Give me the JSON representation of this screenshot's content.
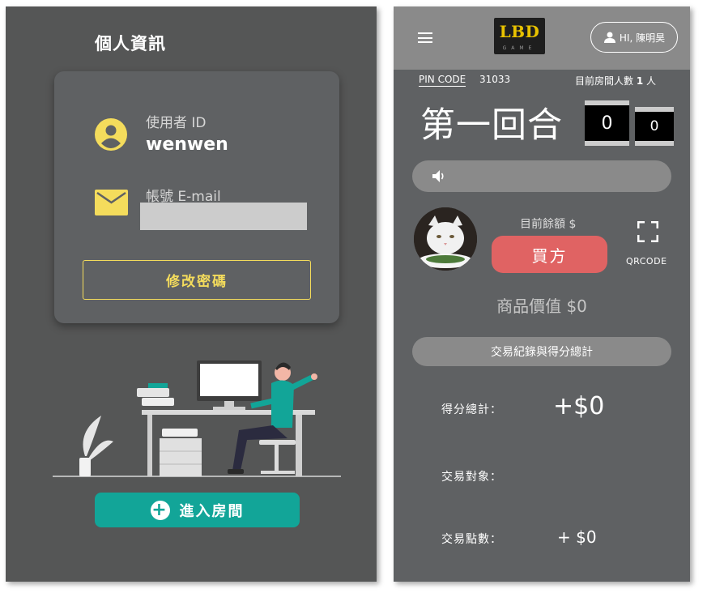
{
  "profile": {
    "title": "個人資訊",
    "user_id_label": "使用者 ID",
    "user_id_value": "wenwen",
    "email_label": "帳號 E-mail",
    "change_password_label": "修改密碼",
    "enter_room_label": "進入房間"
  },
  "game": {
    "logo_text": "LBD",
    "logo_subtext": "GAME",
    "greeting": "HI, 陳明昊",
    "pin_label": "PIN CODE",
    "pin_value": "31033",
    "room_count_prefix": "目前房間人數",
    "room_count_value": "1",
    "room_count_suffix": "人",
    "round_title": "第一回合",
    "score_a": "0",
    "score_b": "0",
    "balance_label": "目前餘額 $",
    "role_label": "買方",
    "qrcode_label": "QRCODE",
    "goods_value_label": "商品價值 $0",
    "records_label": "交易紀錄與得分總計",
    "total_score_label": "得分總計：",
    "total_score_value": "+$0",
    "trade_partner_label": "交易對象：",
    "trade_points_label": "交易點數：",
    "trade_points_value": "+ $0"
  },
  "colors": {
    "teal": "#12a598",
    "yellow": "#f4dc5c",
    "buyer_red": "#e06363",
    "logo_gold": "#e8c200"
  }
}
